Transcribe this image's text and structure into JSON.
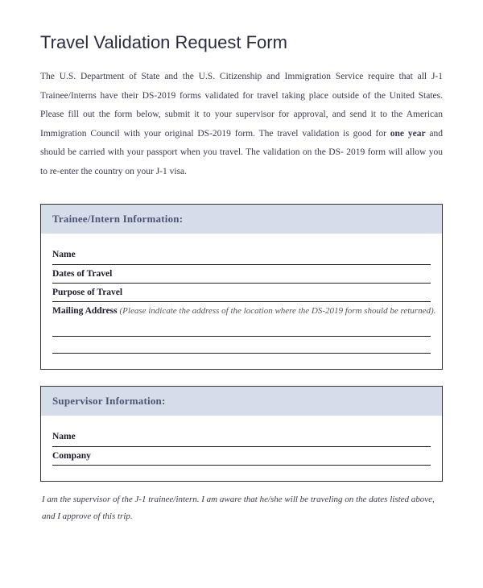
{
  "title": "Travel Validation Request Form",
  "intro_parts": {
    "p1": "The U.S. Department of State and the U.S. Citizenship and Immigration Service require that all J-1 Trainee/Interns have their DS-2019 forms validated for travel taking place outside of the United States. Please fill out the form below, submit it to your supervisor for approval, and send it to the American Immigration Council with your original DS-2019 form. The travel validation is good for ",
    "bold": "one year",
    "p2": " and should be carried with your passport when you travel. The validation on the DS- 2019 form will allow you to re-enter the country on your J-1 visa."
  },
  "section1": {
    "header": "Trainee/Intern Information:",
    "fields": {
      "name": "Name",
      "dates": "Dates of Travel",
      "purpose": "Purpose of Travel",
      "mailing": "Mailing Address",
      "mailing_hint": "(Please indicate the address of the location where the DS-2019 form should be returned)."
    }
  },
  "section2": {
    "header": "Supervisor Information:",
    "fields": {
      "name": "Name",
      "company": "Company"
    },
    "statement": "I am the supervisor of the J-1 trainee/intern. I am aware that he/she will be traveling on the dates listed above, and I approve of this trip."
  }
}
